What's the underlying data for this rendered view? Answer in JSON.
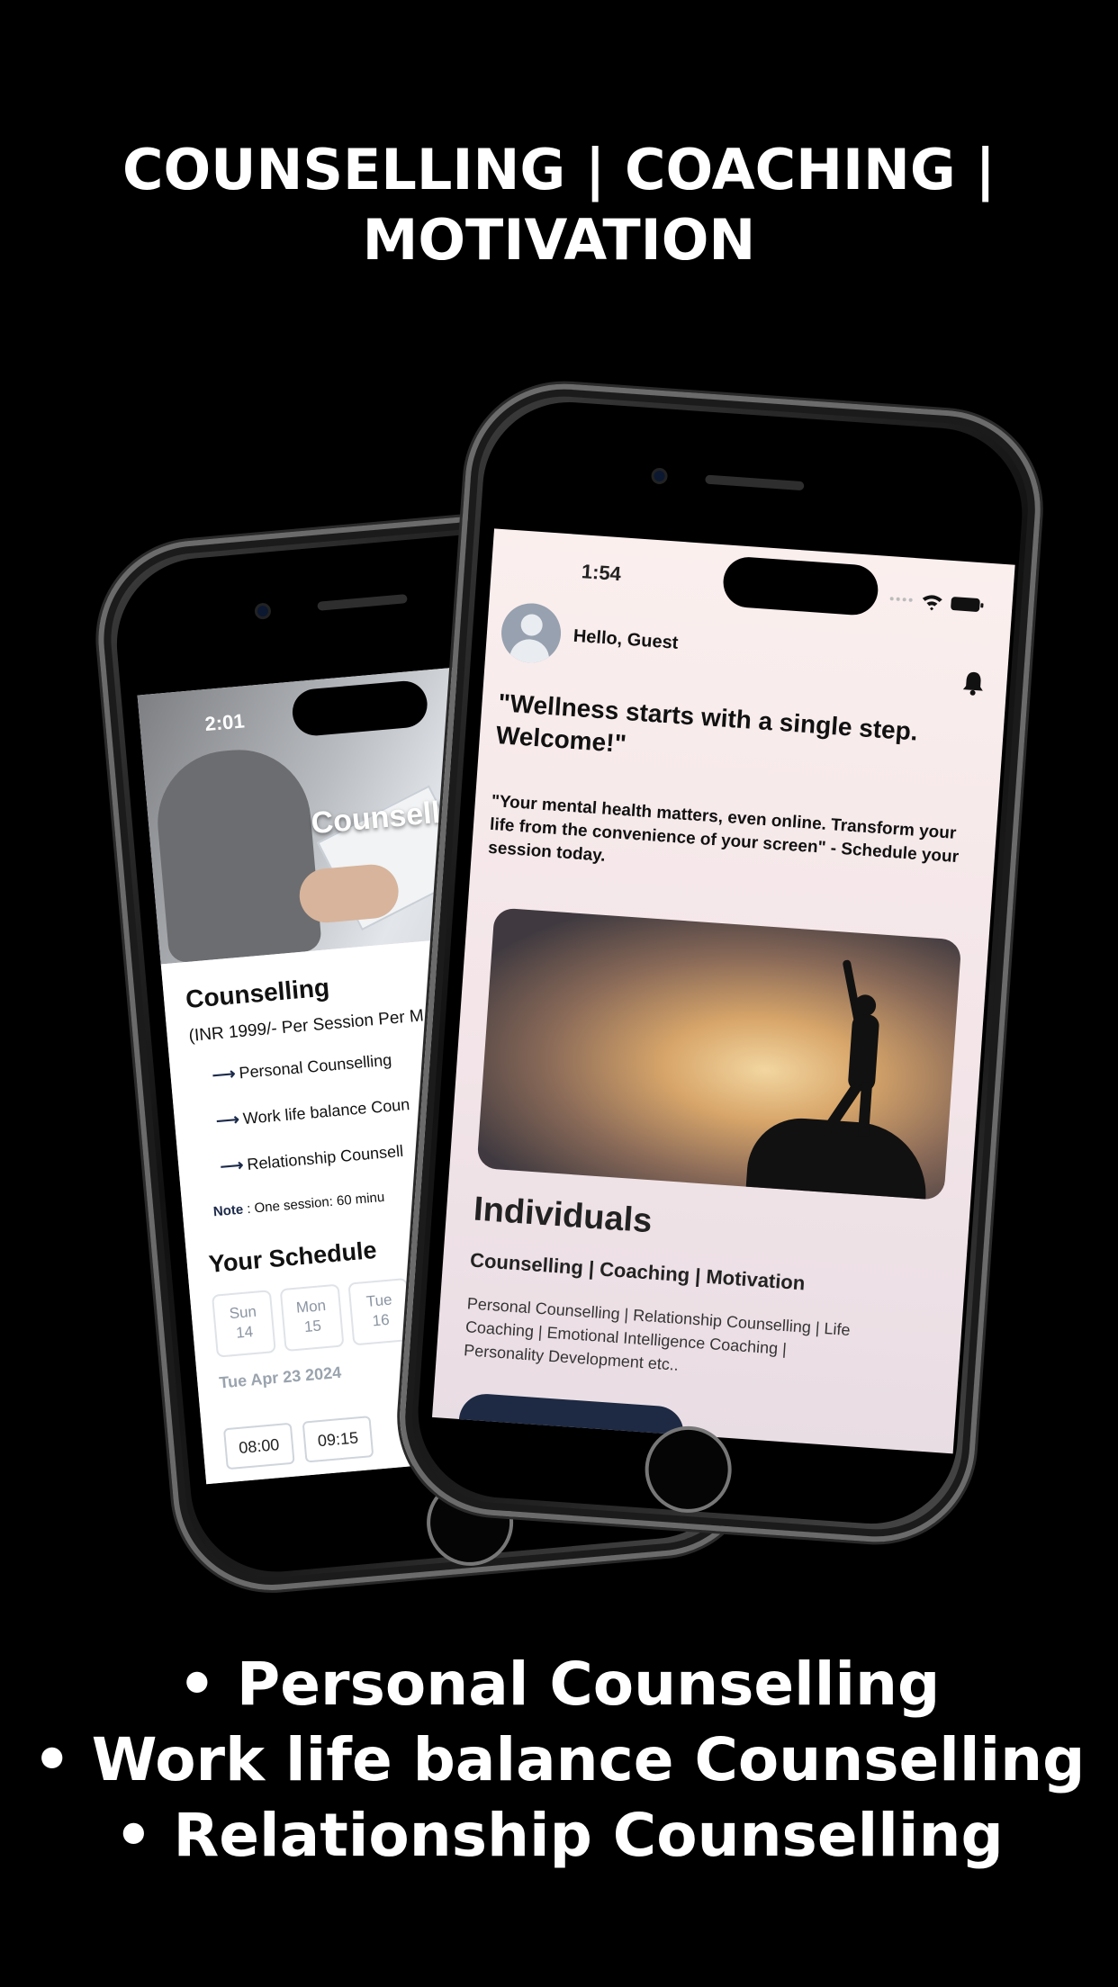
{
  "headline": {
    "line1": "COUNSELLING | COACHING |",
    "line2": "MOTIVATION"
  },
  "bullets": [
    "• Personal Counselling",
    "•  Work life balance Counselling",
    "• Relationship Counselling"
  ],
  "back_screen": {
    "status_time": "2:01",
    "hero_title": "Counselli",
    "title": "Counselling",
    "price": "(INR 1999/- Per Session Per M",
    "items": [
      "Personal Counselling",
      "Work life balance Coun",
      "Relationship Counsell"
    ],
    "arrow": "⟶",
    "note_label": "Note",
    "note_text": " : One session: 60 minu",
    "schedule_title": "Your Schedule",
    "days": [
      {
        "name": "Sun",
        "num": "14"
      },
      {
        "name": "Mon",
        "num": "15"
      },
      {
        "name": "Tue",
        "num": "16"
      }
    ],
    "selected_date": "Tue Apr 23 2024",
    "times": [
      "08:00",
      "09:15"
    ]
  },
  "front_screen": {
    "status_time": "1:54",
    "greeting": "Hello, Guest",
    "welcome": "\"Wellness starts with a single step. Welcome!\"",
    "quote": "\"Your mental health matters, even online. Transform your life from the convenience of your screen\" - Schedule your session today.",
    "section_title": "Individuals",
    "section_subtitle": "Counselling | Coaching | Motivation",
    "section_desc": "Personal Counselling | Relationship Counselling | Life Coaching | Emotional Intelligence Coaching | Personality Development etc.."
  }
}
